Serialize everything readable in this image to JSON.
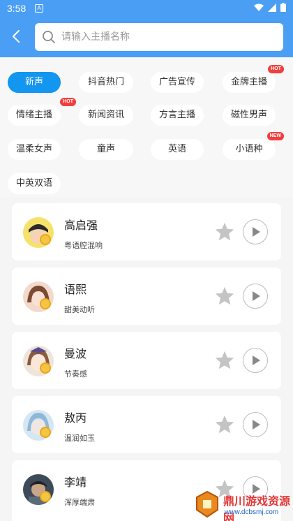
{
  "status_bar": {
    "time": "3:58",
    "notification_letter": "A"
  },
  "search": {
    "placeholder": "请输入主播名称"
  },
  "categories": [
    {
      "label": "新声",
      "active": true
    },
    {
      "label": "抖音热门"
    },
    {
      "label": "广告宣传"
    },
    {
      "label": "金牌主播",
      "badge": "HOT"
    },
    {
      "label": "情绪主播",
      "badge": "HOT"
    },
    {
      "label": "新闻资讯"
    },
    {
      "label": "方言主播"
    },
    {
      "label": "磁性男声"
    },
    {
      "label": "温柔女声"
    },
    {
      "label": "童声"
    },
    {
      "label": "英语"
    },
    {
      "label": "小语种",
      "badge": "NEW"
    },
    {
      "label": "中英双语"
    }
  ],
  "anchors": [
    {
      "name": "高启强",
      "desc": "粤语腔混响"
    },
    {
      "name": "语熙",
      "desc": "甜美动听"
    },
    {
      "name": "曼波",
      "desc": "节奏感"
    },
    {
      "name": "敖丙",
      "desc": "温润如玉"
    },
    {
      "name": "李靖",
      "desc": "浑厚端肃"
    }
  ],
  "watermark": {
    "title": "鼎川游戏资源网",
    "url": "www.dcbsmj.com"
  },
  "colors": {
    "header": "#4a9ff5",
    "active_chip": "#1296f0",
    "badge": "#f23e3e",
    "star": "#c4c4c4"
  }
}
